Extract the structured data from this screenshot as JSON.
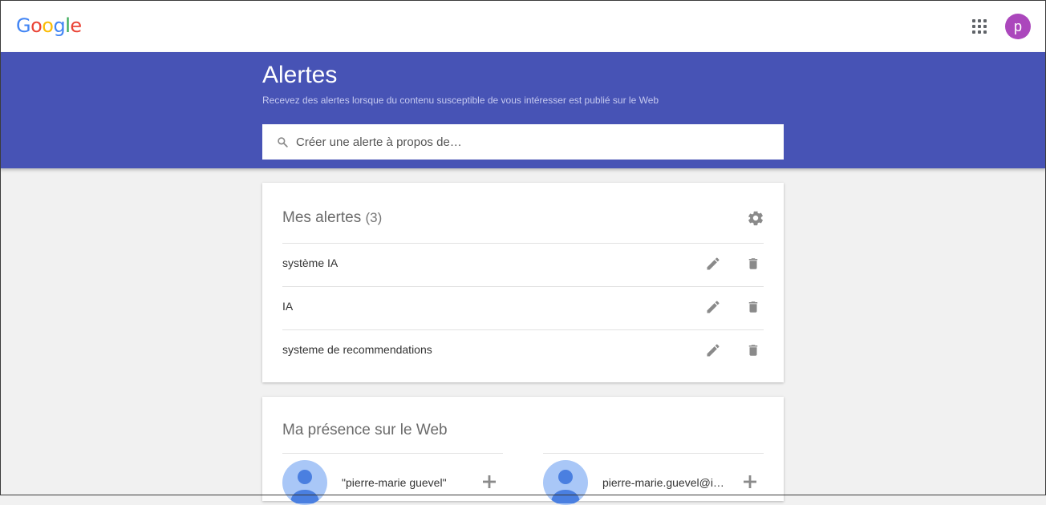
{
  "app": {
    "logo_letters": [
      {
        "ch": "G",
        "color": "#4285F4"
      },
      {
        "ch": "o",
        "color": "#EA4335"
      },
      {
        "ch": "o",
        "color": "#FBBC05"
      },
      {
        "ch": "g",
        "color": "#4285F4"
      },
      {
        "ch": "l",
        "color": "#34A853"
      },
      {
        "ch": "e",
        "color": "#EA4335"
      }
    ]
  },
  "topbar": {
    "avatar_letter": "p",
    "avatar_color": "#ab47bc",
    "apps_icon": "apps-grid-icon"
  },
  "header": {
    "background": "#4753b5",
    "title": "Alertes",
    "subtitle": "Recevez des alertes lorsque du contenu susceptible de vous intéresser est publié sur le Web",
    "search_placeholder": "Créer une alerte à propos de…",
    "search_value": ""
  },
  "alerts": {
    "title": "Mes alertes",
    "count": "(3)",
    "settings_icon": "gear-icon",
    "items": [
      {
        "label": "système IA"
      },
      {
        "label": "IA"
      },
      {
        "label": "systeme de recommendations"
      }
    ]
  },
  "presence": {
    "title": "Ma présence sur le Web",
    "items": [
      {
        "label": "\"pierre-marie guevel\""
      },
      {
        "label": "pierre-marie.guevel@i…"
      }
    ]
  }
}
